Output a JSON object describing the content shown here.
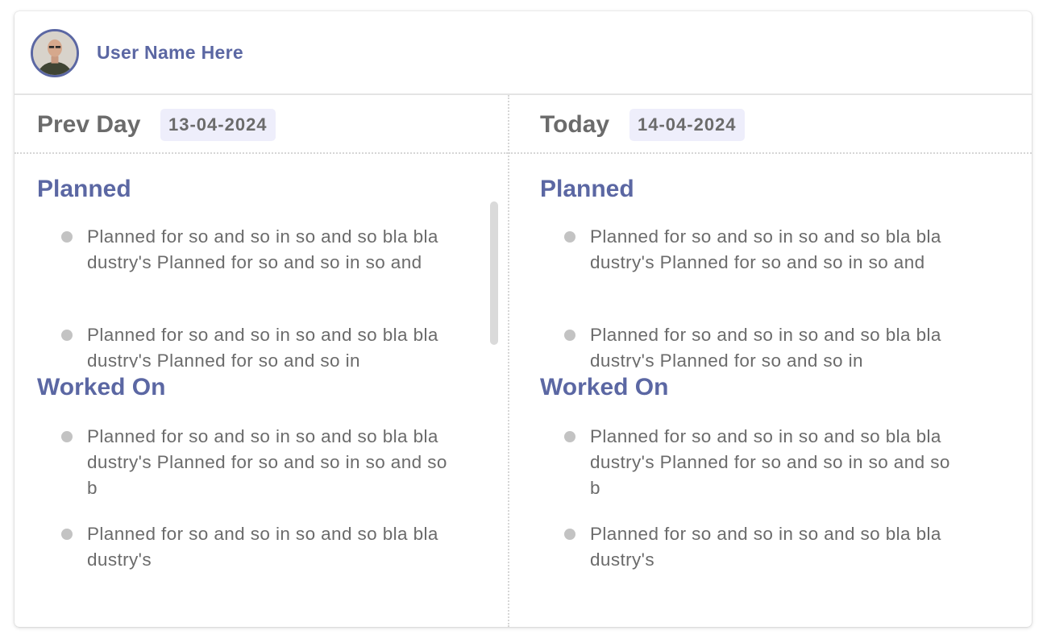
{
  "header": {
    "user_name": "User Name Here"
  },
  "prev_day": {
    "label": "Prev Day",
    "date": "13-04-2024",
    "planned_title": "Planned",
    "planned_items": [
      "Planned for so and so in so and so bla bla dustry's  Planned for so and so in so and",
      "Planned for so and so in so and so bla bla dustry's  Planned for so and so in"
    ],
    "worked_title": "Worked On",
    "worked_items": [
      "Planned for so and so in so and so bla bla dustry's  Planned for so and so in so and so b",
      "Planned for so and so in so and so bla bla dustry's"
    ]
  },
  "today": {
    "label": "Today",
    "date": "14-04-2024",
    "planned_title": "Planned",
    "planned_items": [
      "Planned for so and so in so and so bla bla dustry's  Planned for so and so in so and",
      "Planned for so and so in so and so bla bla dustry's  Planned for so and so in"
    ],
    "worked_title": "Worked On",
    "worked_items": [
      "Planned for so and so in so and so bla bla dustry's  Planned for so and so in so and so b",
      "Planned for so and so in so and so bla bla dustry's"
    ]
  },
  "colors": {
    "accent": "#5b67a3",
    "text": "#6b6b6b",
    "badge_bg": "#eeeefb",
    "bullet": "#c3c3c3"
  },
  "icons": {
    "avatar": "user-avatar-photo"
  }
}
